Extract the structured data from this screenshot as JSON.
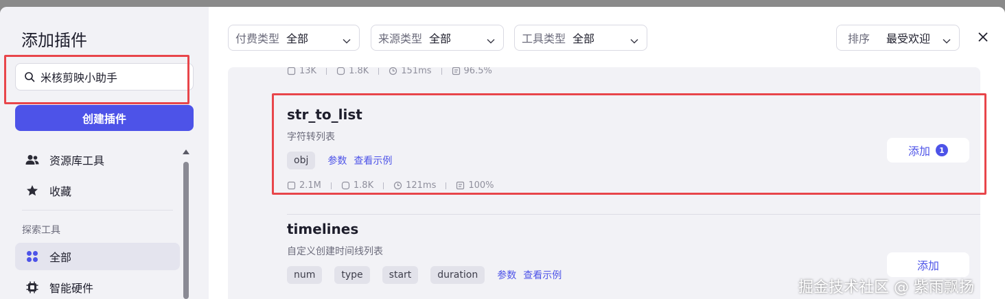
{
  "dialog": {
    "title": "添加插件",
    "close_icon": "close-icon"
  },
  "sidebar": {
    "search": {
      "value": "米核剪映小助手",
      "icon": "search-icon"
    },
    "create_button": "创建插件",
    "items": [
      {
        "label": "资源库工具",
        "icon": "users-icon"
      },
      {
        "label": "收藏",
        "icon": "star-icon"
      }
    ],
    "section_label": "探索工具",
    "explore_items": [
      {
        "label": "全部",
        "icon": "grid-icon",
        "active": true
      },
      {
        "label": "智能硬件",
        "icon": "chip-icon"
      }
    ]
  },
  "filters": [
    {
      "label": "付费类型",
      "value": "全部"
    },
    {
      "label": "来源类型",
      "value": "全部"
    },
    {
      "label": "工具类型",
      "value": "全部"
    }
  ],
  "sort": {
    "label": "排序",
    "value": "最受欢迎"
  },
  "plugins": [
    {
      "stats": {
        "calls": "13K",
        "users": "1.8K",
        "latency": "151ms",
        "success": "96.5%"
      }
    },
    {
      "name": "str_to_list",
      "description": "字符转列表",
      "tags": [
        "obj"
      ],
      "links": [
        "参数",
        "查看示例"
      ],
      "stats": {
        "calls": "2.1M",
        "users": "1.8K",
        "latency": "121ms",
        "success": "100%"
      },
      "add_label": "添加",
      "add_count": "1"
    },
    {
      "name": "timelines",
      "description": "自定义创建时间线列表",
      "tags": [
        "num",
        "type",
        "start",
        "duration"
      ],
      "links": [
        "参数",
        "查看示例"
      ],
      "add_label": "添加"
    }
  ],
  "watermark": "掘金技术社区 @ 紫雨飘扬",
  "colors": {
    "accent": "#4d53e8",
    "highlight": "#e8454a"
  }
}
